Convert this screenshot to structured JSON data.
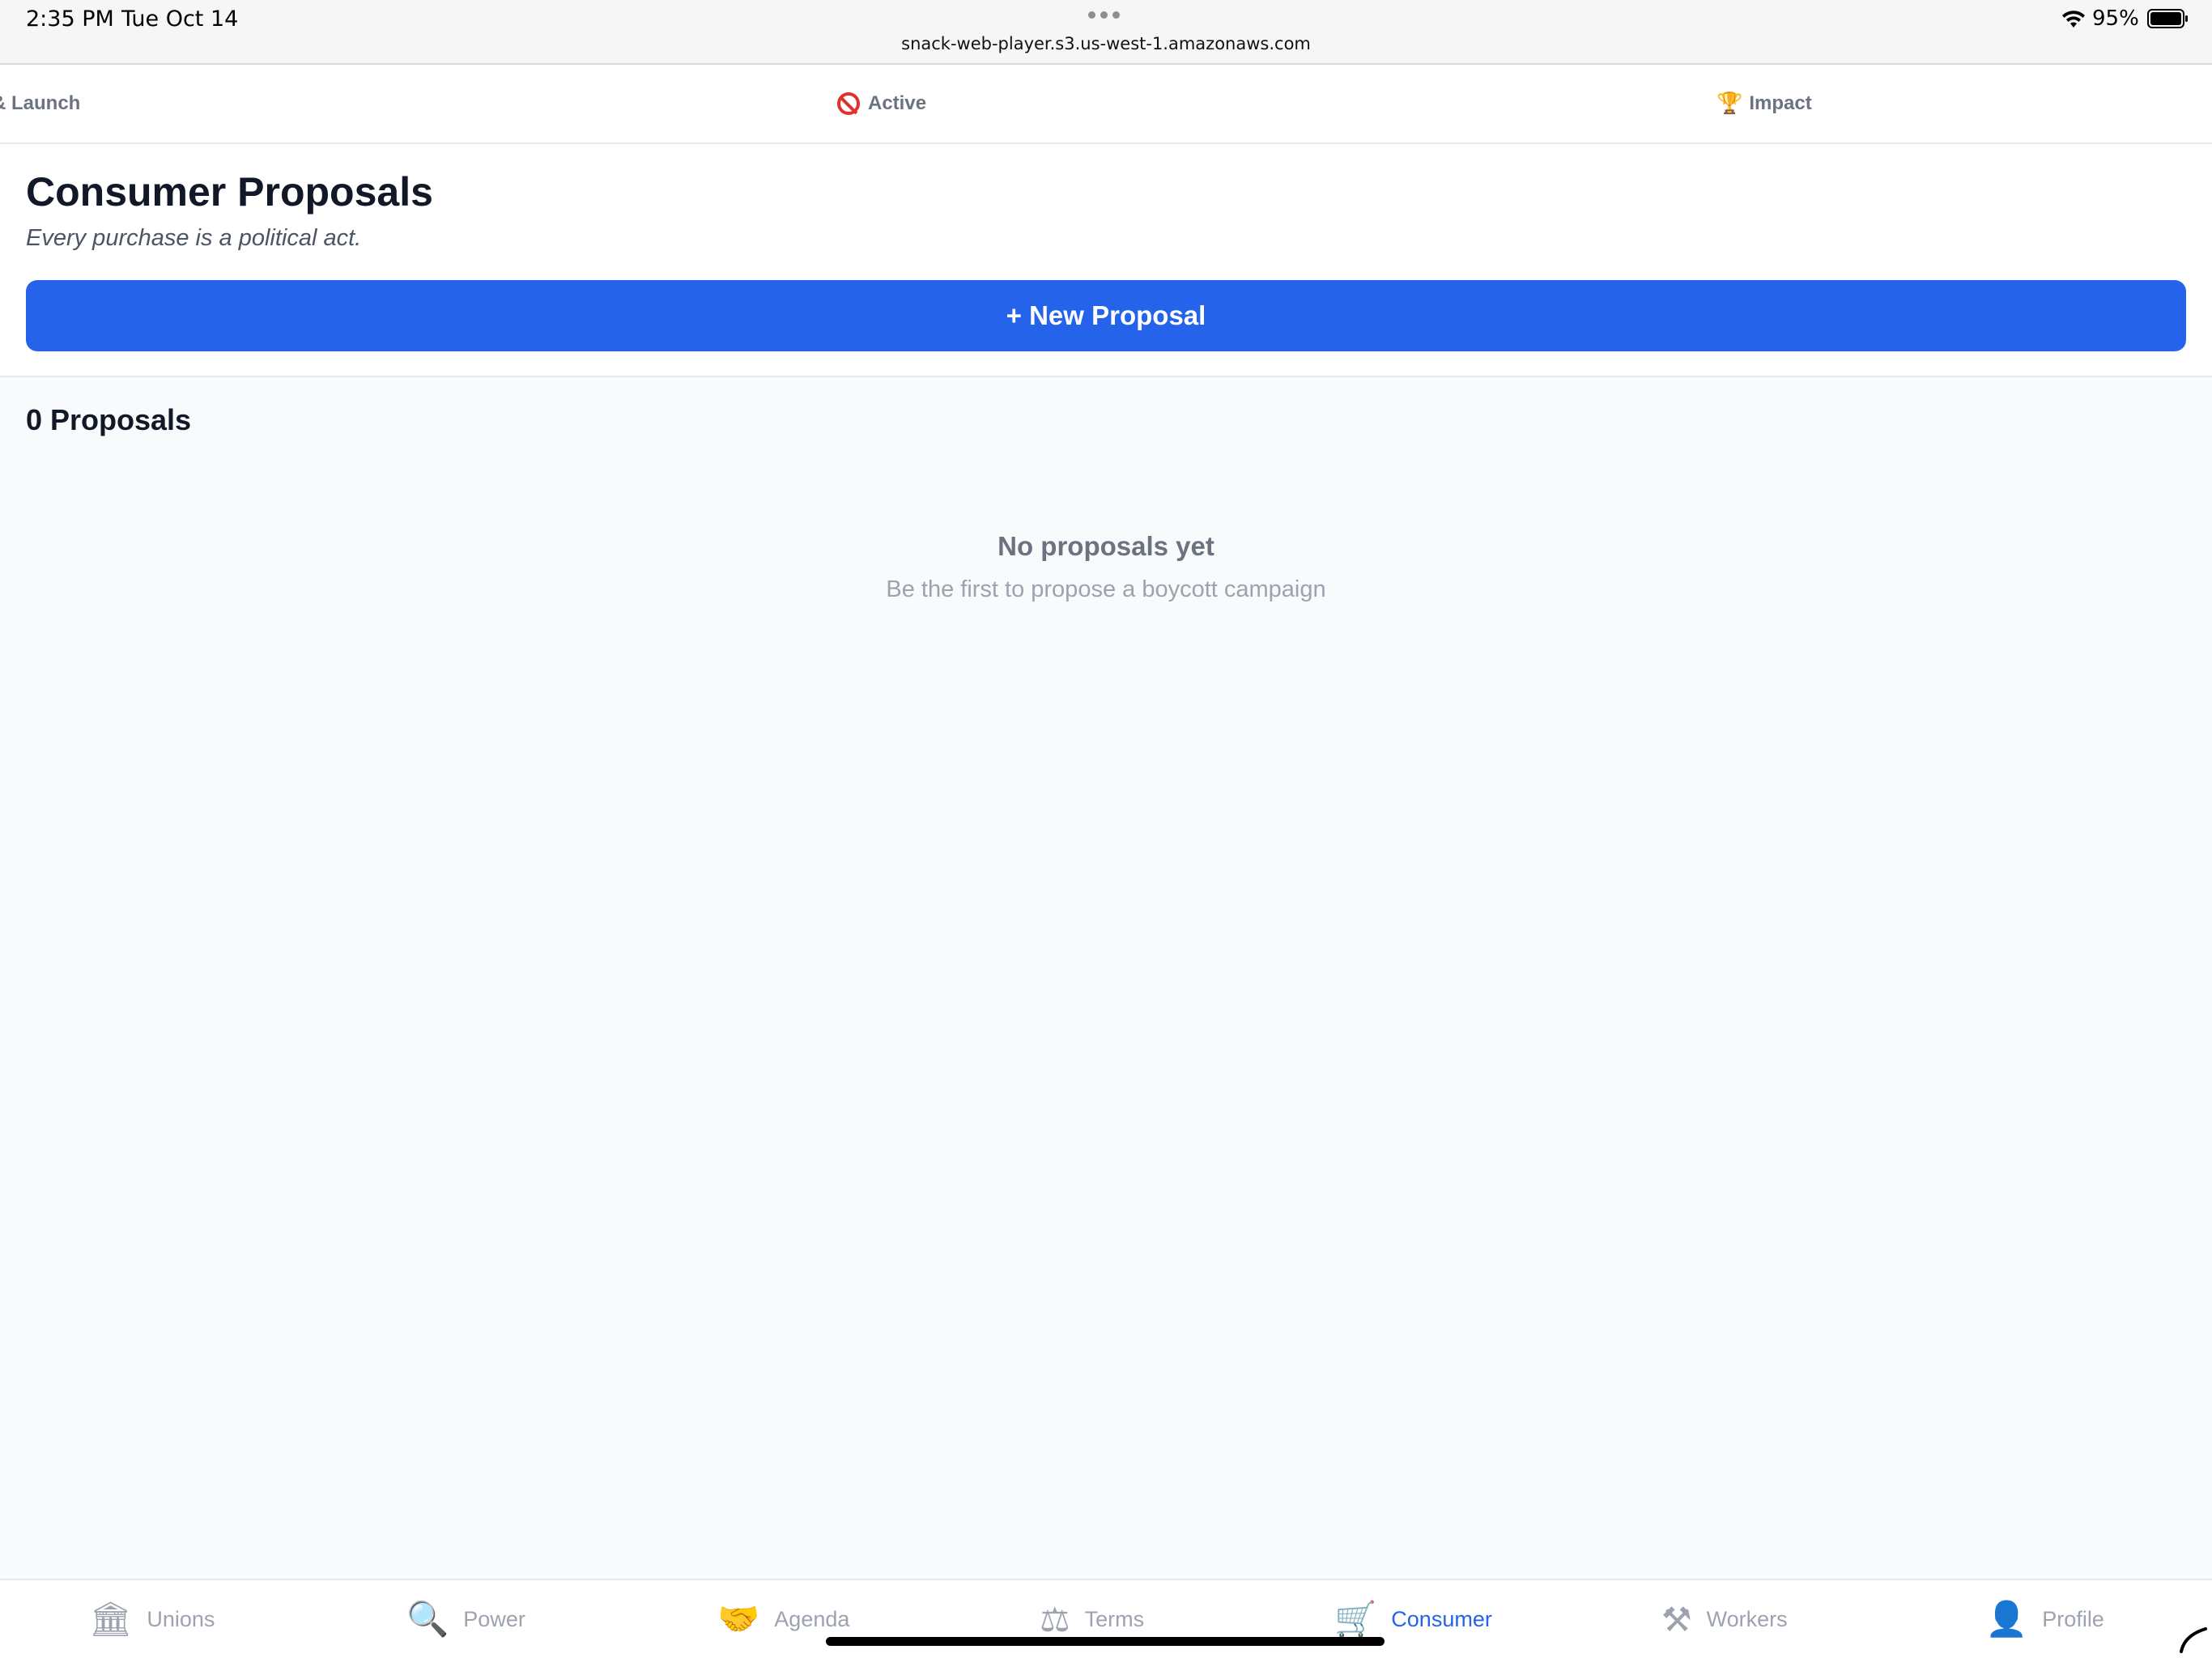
{
  "status_bar": {
    "time": "2:35 PM",
    "date": "Tue Oct 14",
    "url": "snack-web-player.s3.us-west-1.amazonaws.com",
    "battery": "95%"
  },
  "top_tabs": [
    {
      "label": "& Launch",
      "icon": ""
    },
    {
      "label": "Active",
      "icon": "no-entry-icon"
    },
    {
      "label": "Impact",
      "icon": "🏆"
    }
  ],
  "header": {
    "title": "Consumer Proposals",
    "subtitle": "Every purchase is a political act.",
    "new_button": "+ New Proposal"
  },
  "content": {
    "count_label": "0 Proposals",
    "empty_title": "No proposals yet",
    "empty_subtitle": "Be the first to propose a boycott campaign"
  },
  "bottom_tabs": [
    {
      "label": "Unions",
      "icon": "🏛"
    },
    {
      "label": "Power",
      "icon": "🔍"
    },
    {
      "label": "Agenda",
      "icon": "🤝"
    },
    {
      "label": "Terms",
      "icon": "⚖"
    },
    {
      "label": "Consumer",
      "icon": "🛒",
      "active": true
    },
    {
      "label": "Workers",
      "icon": "⚒"
    },
    {
      "label": "Profile",
      "icon": "👤"
    }
  ],
  "colors": {
    "accent": "#2563eb",
    "title": "#111827",
    "muted": "#6b7280",
    "background": "#f9fafb"
  }
}
